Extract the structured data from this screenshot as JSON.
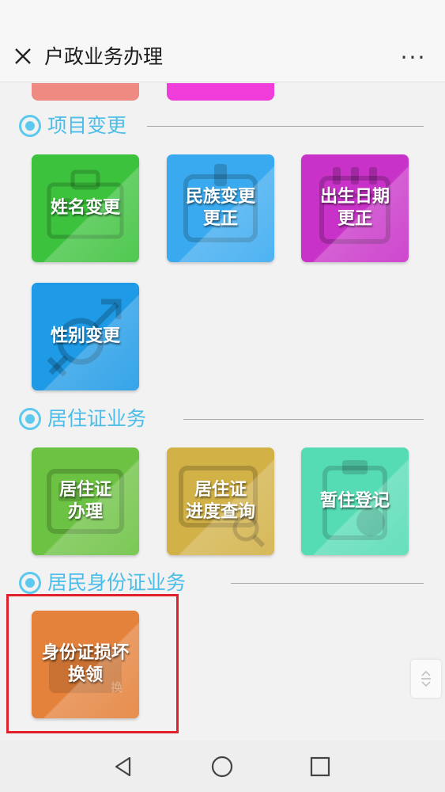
{
  "header": {
    "title": "户政业务办理",
    "close_icon": "close-icon",
    "more_label": "···"
  },
  "colors": {
    "accent": "#4cbde8",
    "highlight": "#e0202a"
  },
  "sections": [
    {
      "title": "项目变更",
      "tiles": [
        {
          "label": "姓名变更",
          "color": "#3cc23c",
          "icon": "id-card-icon"
        },
        {
          "label": "民族变更\n更正",
          "color": "#3aaaf0",
          "icon": "badge-icon"
        },
        {
          "label": "出生日期\n更正",
          "color": "#c832c8",
          "icon": "calendar-icon"
        },
        {
          "label": "性别变更",
          "color": "#1e9ae6",
          "icon": "gender-icon"
        }
      ]
    },
    {
      "title": "居住证业务",
      "tiles": [
        {
          "label": "居住证\n办理",
          "color": "#6cc242",
          "icon": "card-icon"
        },
        {
          "label": "居住证\n进度查询",
          "color": "#d2b146",
          "icon": "search-card-icon"
        },
        {
          "label": "暂住登记",
          "color": "#56dcb4",
          "icon": "clipboard-user-icon"
        }
      ]
    },
    {
      "title": "居民身份证业务",
      "tiles": [
        {
          "label": "身份证损坏\n换领",
          "color": "#e4813a",
          "icon": "exchange-card-icon",
          "badge": "换"
        }
      ]
    }
  ],
  "navbar": {
    "back_icon": "back-triangle-icon",
    "home_icon": "home-circle-icon",
    "recents_icon": "recents-square-icon"
  }
}
